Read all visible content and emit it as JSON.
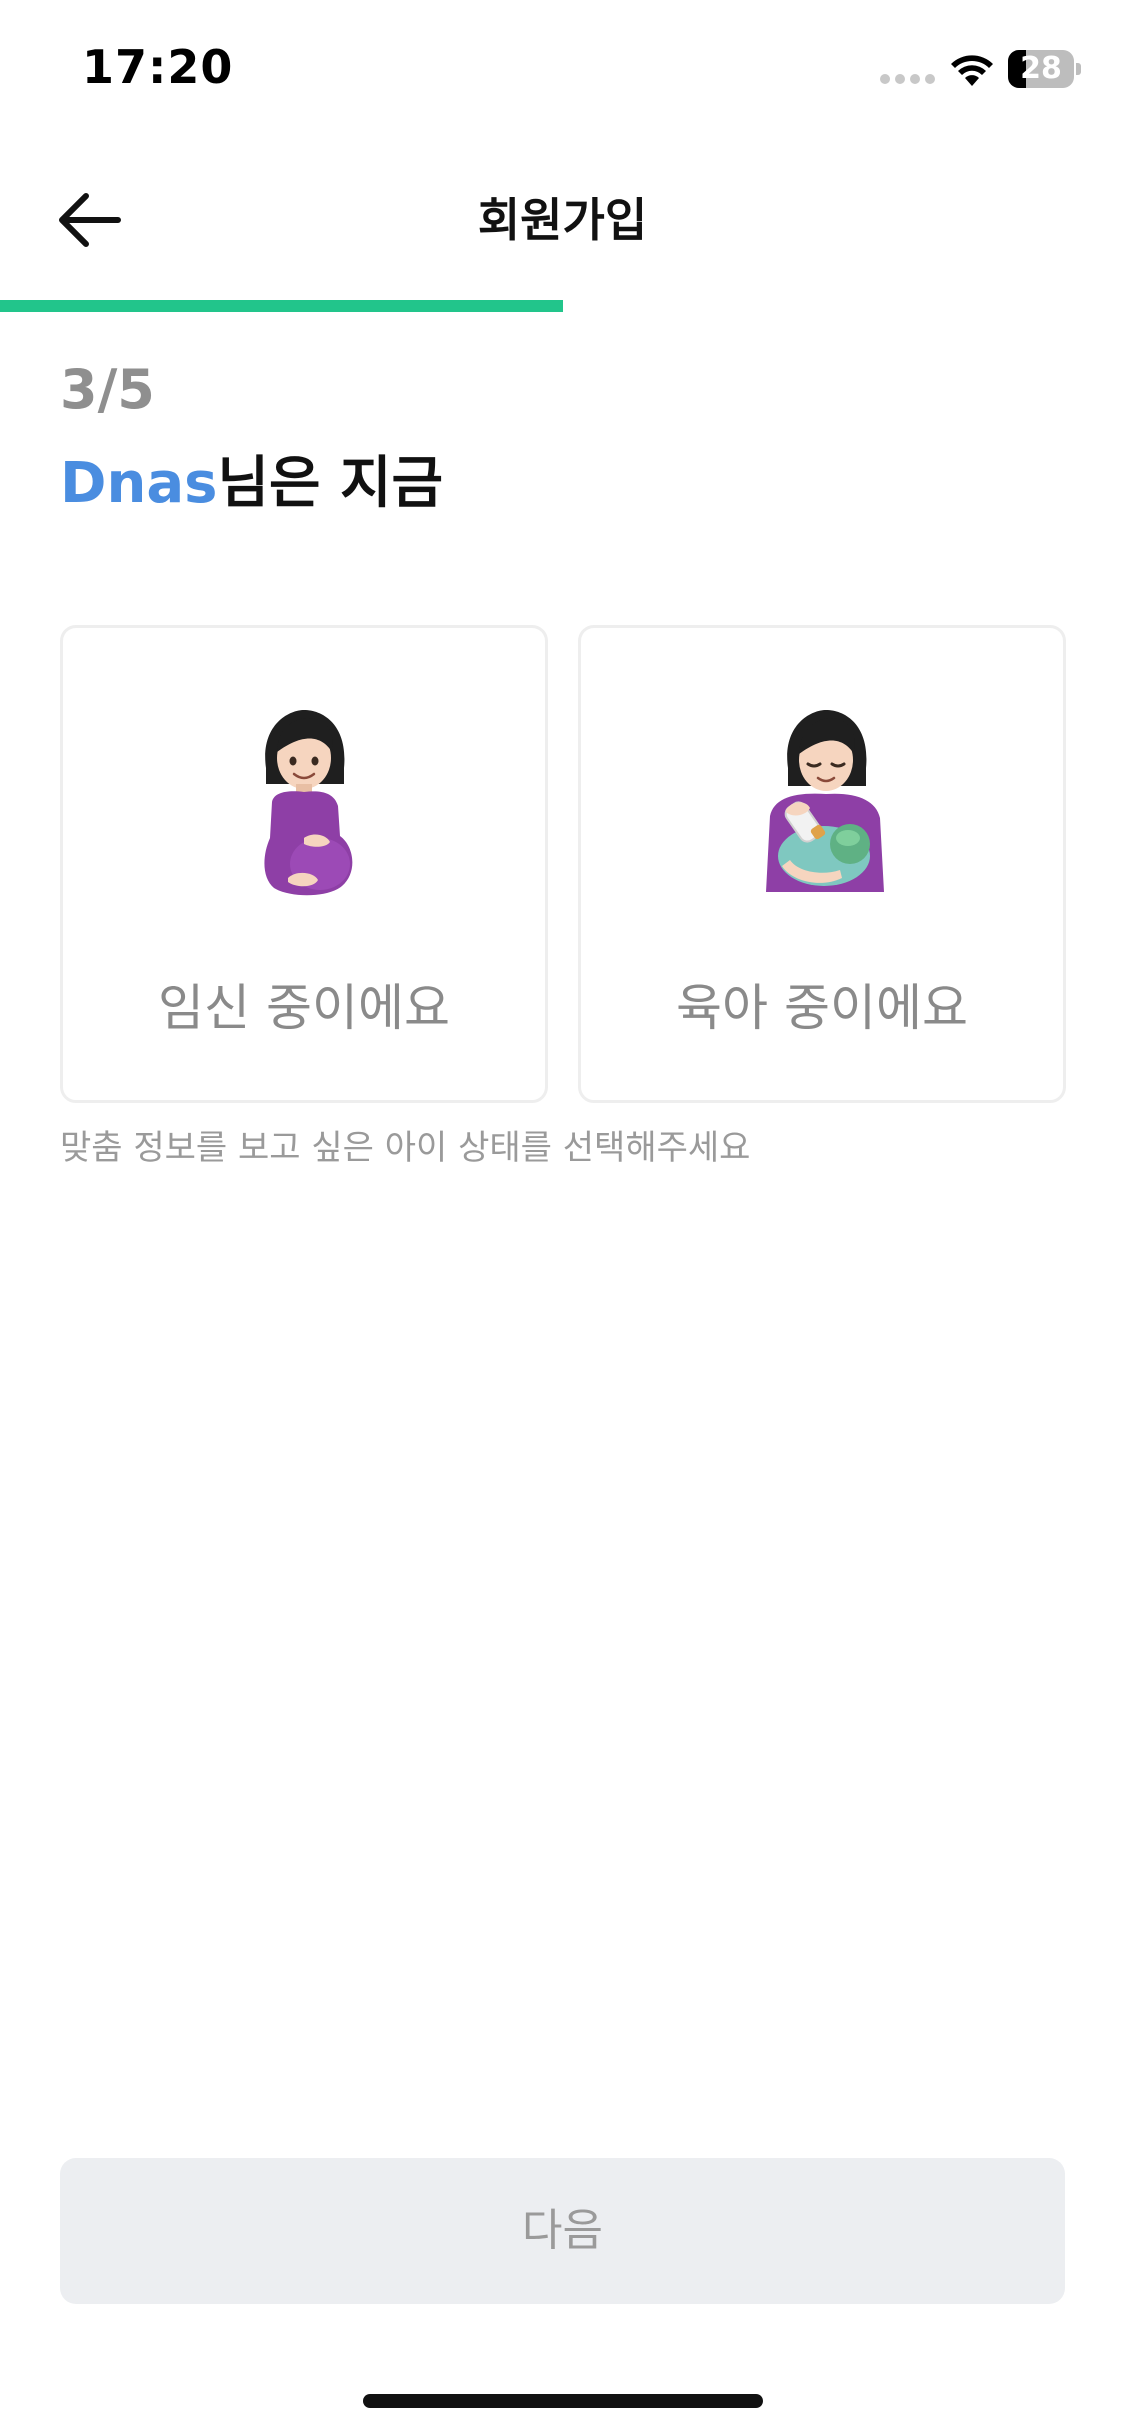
{
  "status_bar": {
    "time": "17:20",
    "battery": "28",
    "battery_level": 0.28,
    "icons": [
      "signal-dots-icon",
      "wifi-icon",
      "battery-icon"
    ]
  },
  "header": {
    "title": "회원가입",
    "back_icon": "arrow-left-icon"
  },
  "progress": {
    "current_step": 3,
    "total_steps": 5,
    "fraction": 0.5,
    "color": "#22c58b"
  },
  "step": {
    "label": "3/5"
  },
  "question": {
    "user_name": "Dnas",
    "suffix": "님은 지금",
    "name_color": "#4a8de0"
  },
  "options": [
    {
      "label": "임신 중이에요",
      "icon": "pregnant-woman-emoji"
    },
    {
      "label": "육아 중이에요",
      "icon": "breastfeeding-emoji"
    }
  ],
  "helper_text": "맞춤 정보를 보고 싶은 아이 상태를 선택해주세요",
  "footer": {
    "next_label": "다음"
  }
}
